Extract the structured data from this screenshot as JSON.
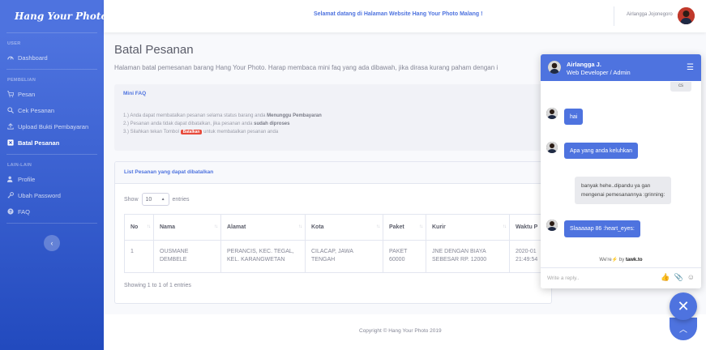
{
  "brand": {
    "name": "Hang Your Photo"
  },
  "sidebar": {
    "sections": [
      {
        "heading": "USER",
        "items": [
          {
            "label": "Dashboard",
            "icon": "gauge-icon"
          }
        ]
      },
      {
        "heading": "PEMBELIAN",
        "items": [
          {
            "label": "Pesan",
            "icon": "cart-icon"
          },
          {
            "label": "Cek Pesanan",
            "icon": "search-icon"
          },
          {
            "label": "Upload Bukti Pembayaran",
            "icon": "upload-icon"
          },
          {
            "label": "Batal Pesanan",
            "icon": "cancel-box-icon",
            "active": true
          }
        ]
      },
      {
        "heading": "LAIN-LAIN",
        "items": [
          {
            "label": "Profile",
            "icon": "user-icon"
          },
          {
            "label": "Ubah Password",
            "icon": "key-icon"
          },
          {
            "label": "FAQ",
            "icon": "question-icon"
          }
        ]
      }
    ],
    "toggle_glyph": "‹"
  },
  "topbar": {
    "welcome": "Selamat datang di Halaman Website Hang Your Photo Malang !",
    "username": "Airlangga Jojonegoro"
  },
  "page": {
    "title": "Batal Pesanan",
    "description": "Halaman batal pemesanan barang Hang Your Photo. Harap membaca mini faq yang ada dibawah, jika dirasa kurang paham dengan i"
  },
  "faq": {
    "title": "Mini FAQ",
    "line1_pre": "1.) Anda dapat membatalkan pesanan selama status barang anda ",
    "line1_bold": "Menunggu Pembayaran",
    "line2_pre": "2.) Pesanan anda tidak dapat dibatalkan, jika pesanan anda ",
    "line2_bold": "sudah diproses",
    "line3_pre": "3.) Silahkan tekan Tombol ",
    "line3_badge": "Batalkan",
    "line3_post": " untuk membatalkan pesanan anda"
  },
  "list": {
    "title": "List Pesanan yang dapat dibatalkan",
    "show_label": "Show",
    "entries_value": "10",
    "entries_label": "entries",
    "columns": [
      "No",
      "Nama",
      "Alamat",
      "Kota",
      "Paket",
      "Kurir",
      "Waktu P"
    ],
    "rows": [
      {
        "no": "1",
        "nama1": "OUSMANE",
        "nama2": "DEMBELE",
        "alamat1": "PERANCIS, KEC. TEGAL,",
        "alamat2": "KEL. KARANGWETAN",
        "kota1": "CILACAP, JAWA",
        "kota2": "TENGAH",
        "paket1": "PAKET",
        "paket2": "60000",
        "kurir1": "JNE DENGAN BIAYA",
        "kurir2": "SEBESAR RP. 12000",
        "waktu1": "2020-01",
        "waktu2": "21:49:54"
      }
    ],
    "info": "Showing 1 to 1 of 1 entries"
  },
  "footer": {
    "copyright": "Copyright © Hang Your Photo 2019"
  },
  "chat": {
    "agent_name": "Airlangga J.",
    "agent_role": "Web Developer / Admin",
    "cut_text": "cs",
    "messages": [
      {
        "from": "agent",
        "text": "hai"
      },
      {
        "from": "agent",
        "text": "Apa yang anda keluhkan"
      },
      {
        "from": "visitor",
        "line1": "banyak hehe..dipandu ya gan",
        "line2": "mengenai pemesanannya :grinning:"
      },
      {
        "from": "agent",
        "text": "Slaaaaap 86 :heart_eyes:"
      }
    ],
    "powered_pre": "We're",
    "powered_mid": " by ",
    "powered_brand": "tawk.to",
    "input_placeholder": "Write a reply..",
    "close_glyph": "✕",
    "scroll_glyph": "︿"
  },
  "colors": {
    "primary": "#4e73df",
    "danger": "#e74a3b"
  }
}
